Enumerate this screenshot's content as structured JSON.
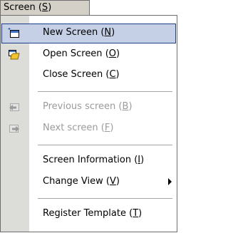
{
  "menubar": {
    "title": "Screen",
    "accel": "S"
  },
  "menu": {
    "new_screen": {
      "label": "New Screen",
      "accel": "N"
    },
    "open_screen": {
      "label": "Open Screen",
      "accel": "O"
    },
    "close_screen": {
      "label": "Close Screen",
      "accel": "C"
    },
    "previous_screen": {
      "label": "Previous screen",
      "accel": "B"
    },
    "next_screen": {
      "label": "Next screen",
      "accel": "F"
    },
    "screen_information": {
      "label": "Screen Information",
      "accel": "I"
    },
    "change_view": {
      "label": "Change View",
      "accel": "V"
    },
    "register_template": {
      "label": "Register Template",
      "accel": "T"
    }
  },
  "icons": {
    "new_screen": "new-screen-icon",
    "open_screen": "open-folder-icon",
    "previous_screen": "previous-screen-icon",
    "next_screen": "next-screen-icon",
    "change_view": "submenu-arrow-icon"
  },
  "colors": {
    "selection_fill": "#c5d0e7",
    "selection_border": "#1b3f8b",
    "gutter": "#dcdcd8",
    "disabled_text": "#9b9b9b"
  }
}
